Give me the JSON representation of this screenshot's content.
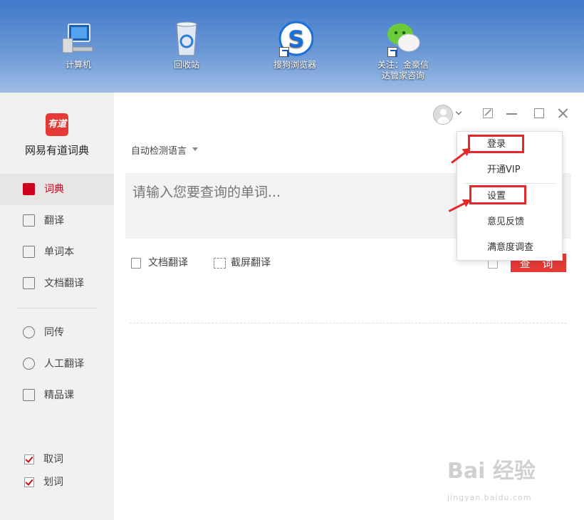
{
  "desktop": {
    "icons": [
      {
        "label": "计算机",
        "icon": "computer-icon"
      },
      {
        "label": "回收站",
        "icon": "recycle-bin-icon"
      },
      {
        "label": "搜狗浏览器",
        "icon": "sogou-browser-icon"
      },
      {
        "label_line1": "关注：金豪信",
        "label_line2": "达管家咨询",
        "icon": "wechat-icon"
      }
    ]
  },
  "app": {
    "name": "网易有道词典",
    "logo_text": "有道",
    "nav": [
      {
        "label": "词典",
        "icon": "dictionary-icon",
        "active": true
      },
      {
        "label": "翻译",
        "icon": "translate-icon"
      },
      {
        "label": "单词本",
        "icon": "wordbook-icon"
      },
      {
        "label": "文档翻译",
        "icon": "document-icon"
      },
      {
        "label": "同传",
        "icon": "simultaneous-icon"
      },
      {
        "label": "人工翻译",
        "icon": "human-translate-icon"
      },
      {
        "label": "精品课",
        "icon": "course-icon"
      }
    ],
    "checks": [
      {
        "label": "取词",
        "checked": true
      },
      {
        "label": "划词",
        "checked": true
      }
    ],
    "language_select": "自动检测语言",
    "query_placeholder": "请输入您要查询的单词...",
    "tools": {
      "doc_translate": "文档翻译",
      "screenshot_translate": "截屏翻译"
    },
    "search_button": "查 词",
    "menu": {
      "items": [
        "登录",
        "开通VIP",
        "设置",
        "意见反馈",
        "满意度调查"
      ],
      "highlighted": [
        "登录",
        "设置"
      ]
    }
  },
  "watermark": {
    "main": "Bai 经验",
    "sub": "jingyan.baidu.com"
  },
  "colors": {
    "accent": "#e53935",
    "highlight": "#e5292b",
    "sidebar_bg": "#f2f1f0",
    "desktop_blue": "#3f79c8"
  }
}
